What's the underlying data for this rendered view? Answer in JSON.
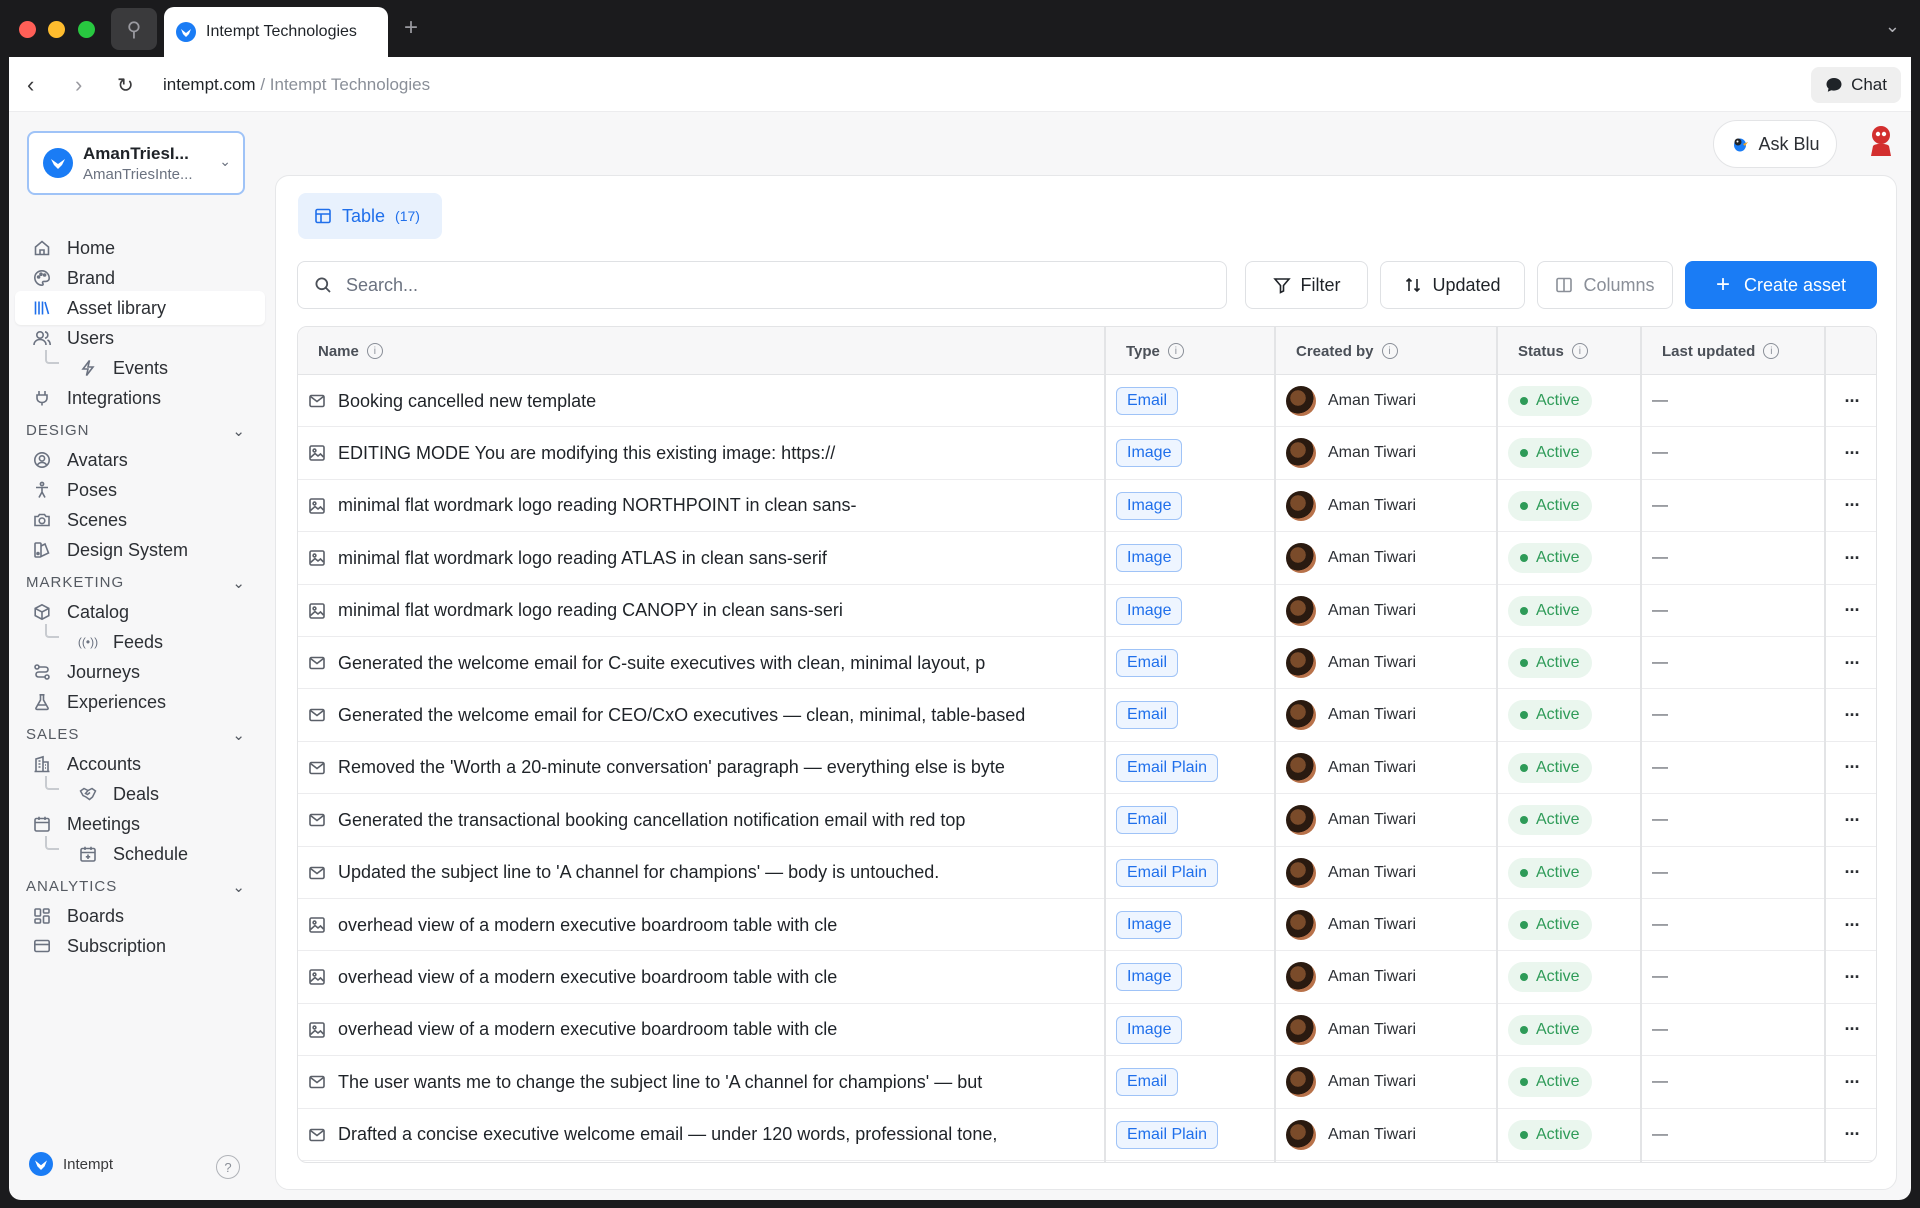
{
  "browser": {
    "tab_title": "Intempt Technologies",
    "url_host": "intempt.com",
    "url_rest": " / Intempt Technologies",
    "chat_label": "Chat"
  },
  "workspace": {
    "name": "AmanTriesI...",
    "subtitle": "AmanTriesInte..."
  },
  "sidebar": {
    "top": [
      {
        "label": "Home",
        "icon": "home-icon"
      },
      {
        "label": "Brand",
        "icon": "palette-icon"
      },
      {
        "label": "Asset library",
        "icon": "library-icon",
        "active": true
      },
      {
        "label": "Users",
        "icon": "users-icon"
      },
      {
        "label": "Events",
        "icon": "bolt-icon",
        "sub": true
      },
      {
        "label": "Integrations",
        "icon": "plug-icon"
      }
    ],
    "design_title": "DESIGN",
    "design": [
      {
        "label": "Avatars",
        "icon": "avatar-icon"
      },
      {
        "label": "Poses",
        "icon": "pose-icon"
      },
      {
        "label": "Scenes",
        "icon": "camera-icon"
      },
      {
        "label": "Design System",
        "icon": "design-system-icon"
      }
    ],
    "marketing_title": "MARKETING",
    "marketing": [
      {
        "label": "Catalog",
        "icon": "box-icon"
      },
      {
        "label": "Feeds",
        "icon": "broadcast-icon",
        "sub": true
      },
      {
        "label": "Journeys",
        "icon": "route-icon"
      },
      {
        "label": "Experiences",
        "icon": "flask-icon"
      }
    ],
    "sales_title": "SALES",
    "sales": [
      {
        "label": "Accounts",
        "icon": "building-icon"
      },
      {
        "label": "Deals",
        "icon": "handshake-icon",
        "sub": true
      },
      {
        "label": "Meetings",
        "icon": "calendar-icon"
      },
      {
        "label": "Schedule",
        "icon": "calendar-add-icon",
        "sub": true
      }
    ],
    "analytics_title": "ANALYTICS",
    "analytics": [
      {
        "label": "Boards",
        "icon": "grid-icon"
      },
      {
        "label": "Subscription",
        "icon": "card-icon"
      }
    ],
    "footer_label": "Intempt",
    "help_label": "?"
  },
  "topright": {
    "ask_label": "Ask Blu"
  },
  "toolbar": {
    "view_label": "Table",
    "view_count": "(17)",
    "search_placeholder": "Search...",
    "filter_label": "Filter",
    "sort_label": "Updated",
    "columns_label": "Columns",
    "create_label": "Create asset"
  },
  "table": {
    "columns": [
      "Name",
      "Type",
      "Created by",
      "Status",
      "Last updated"
    ],
    "rows": [
      {
        "name": "Booking cancelled new template",
        "kind": "email",
        "type": "Email",
        "creator": "Aman Tiwari",
        "status": "Active",
        "updated": "—"
      },
      {
        "name": "EDITING MODE You are modifying this existing image: https://",
        "kind": "image",
        "type": "Image",
        "creator": "Aman Tiwari",
        "status": "Active",
        "updated": "—"
      },
      {
        "name": "minimal flat wordmark logo reading NORTHPOINT in clean sans-",
        "kind": "image",
        "type": "Image",
        "creator": "Aman Tiwari",
        "status": "Active",
        "updated": "—"
      },
      {
        "name": "minimal flat wordmark logo reading ATLAS in clean sans-serif",
        "kind": "image",
        "type": "Image",
        "creator": "Aman Tiwari",
        "status": "Active",
        "updated": "—"
      },
      {
        "name": "minimal flat wordmark logo reading CANOPY in clean sans-seri",
        "kind": "image",
        "type": "Image",
        "creator": "Aman Tiwari",
        "status": "Active",
        "updated": "—"
      },
      {
        "name": "Generated the welcome email for C-suite executives with clean, minimal layout, p",
        "kind": "email",
        "type": "Email",
        "creator": "Aman Tiwari",
        "status": "Active",
        "updated": "—"
      },
      {
        "name": "Generated the welcome email for CEO/CxO executives — clean, minimal, table-based",
        "kind": "email",
        "type": "Email",
        "creator": "Aman Tiwari",
        "status": "Active",
        "updated": "—"
      },
      {
        "name": "Removed the 'Worth a 20-minute conversation' paragraph — everything else is byte",
        "kind": "email",
        "type": "Email Plain",
        "creator": "Aman Tiwari",
        "status": "Active",
        "updated": "—"
      },
      {
        "name": "Generated the transactional booking cancellation notification email with red top",
        "kind": "email",
        "type": "Email",
        "creator": "Aman Tiwari",
        "status": "Active",
        "updated": "—"
      },
      {
        "name": "Updated the subject line to 'A channel for champions' — body is untouched.",
        "kind": "email",
        "type": "Email Plain",
        "creator": "Aman Tiwari",
        "status": "Active",
        "updated": "—"
      },
      {
        "name": "overhead view of a modern executive boardroom table with cle",
        "kind": "image",
        "type": "Image",
        "creator": "Aman Tiwari",
        "status": "Active",
        "updated": "—"
      },
      {
        "name": "overhead view of a modern executive boardroom table with cle",
        "kind": "image",
        "type": "Image",
        "creator": "Aman Tiwari",
        "status": "Active",
        "updated": "—"
      },
      {
        "name": "overhead view of a modern executive boardroom table with cle",
        "kind": "image",
        "type": "Image",
        "creator": "Aman Tiwari",
        "status": "Active",
        "updated": "—"
      },
      {
        "name": "The user wants me to change the subject line to 'A channel for champions' — but",
        "kind": "email",
        "type": "Email",
        "creator": "Aman Tiwari",
        "status": "Active",
        "updated": "—"
      },
      {
        "name": "Drafted a concise executive welcome email — under 120 words, professional tone,",
        "kind": "email",
        "type": "Email Plain",
        "creator": "Aman Tiwari",
        "status": "Active",
        "updated": "—"
      }
    ]
  },
  "colors": {
    "accent": "#1a7cf5",
    "status_green": "#2e9b58",
    "traffic_red": "#ff5f57",
    "traffic_yellow": "#febc2e",
    "traffic_green": "#28c840"
  }
}
